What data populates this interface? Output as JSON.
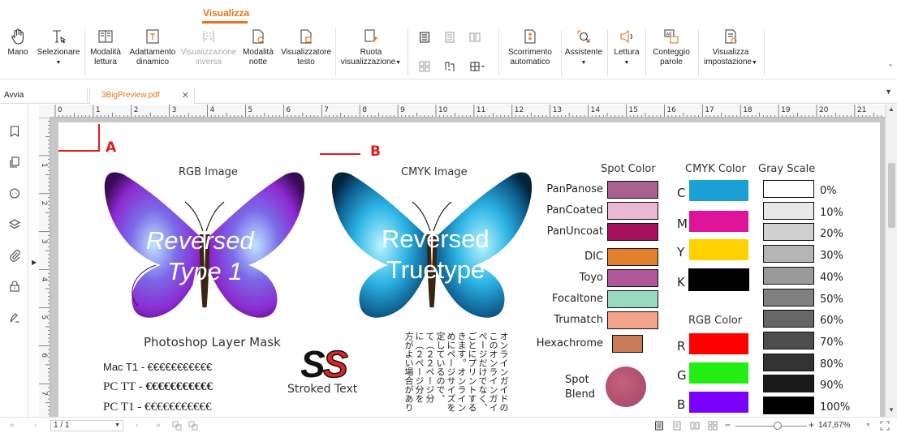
{
  "ribbon": {
    "active_tab": "Visualizza",
    "buttons": {
      "mano": "Mano",
      "selezionare": "Selezionare",
      "modalita_lettura_1": "Modalità",
      "modalita_lettura_2": "lettura",
      "adattamento_1": "Adattamento",
      "adattamento_2": "dinamico",
      "vis_inversa_1": "Visualizzazione",
      "vis_inversa_2": "inversa",
      "mod_notte_1": "Modalità",
      "mod_notte_2": "notte",
      "vis_testo_1": "Visualizzatore",
      "vis_testo_2": "testo",
      "ruota_1": "Ruota",
      "ruota_2": "visualizzazione",
      "scorrimento_1": "Scorrimento",
      "scorrimento_2": "automatico",
      "assistente": "Assistente",
      "lettura": "Lettura",
      "conteggio_1": "Conteggio",
      "conteggio_2": "parole",
      "visualizza_imp_1": "Visualizza",
      "visualizza_imp_2": "impostazione"
    }
  },
  "tabs": {
    "home": "Avvia",
    "file": "3BigPreview.pdf"
  },
  "ruler": {
    "marks": [
      "0",
      "1",
      "2",
      "3",
      "4",
      "5",
      "6",
      "7",
      "8",
      "9",
      "10",
      "11",
      "12",
      "13",
      "14",
      "15",
      "16",
      "17",
      "18",
      "19",
      "20",
      "21"
    ],
    "left_marks": [
      "1",
      "2",
      "3",
      "4",
      "5",
      "6",
      "7"
    ]
  },
  "page": {
    "marker_a": "A",
    "marker_b": "B",
    "rgb_title": "RGB Image",
    "cmyk_title": "CMYK Image",
    "rev_type1_a": "Reversed",
    "rev_type1_b": "Type 1",
    "rev_tt_a": "Reversed",
    "rev_tt_b": "Truetype",
    "ps_mask": "Photoshop Layer Mask",
    "mac_t1_label": "Mac T1 - ",
    "pc_tt_label": "PC TT - ",
    "pc_t1_label": "PC T1 - ",
    "euro_line_1": "€€€€€€€€€€€",
    "euro_line_2": "€€€€€€€€€€€",
    "euro_line_3": "€€€€€€€€€€€",
    "ss_logo_1": "S",
    "ss_logo_2": "S",
    "stroked_text": "Stroked Text",
    "jp_columns": [
      "オンラインガイドの",
      "このオンラインガイ",
      "ページだけでなく、",
      "ごとにプリントする",
      "きます。オンライン",
      "めにページサイズを",
      "定しているので、",
      "て（２２ページ分",
      "に（２ページ分を",
      "方がよい場合があり"
    ],
    "spot_color_title": "Spot Color",
    "cmyk_color_title": "CMYK Color",
    "gray_scale_title": "Gray Scale",
    "rgb_color_title": "RGB Color",
    "spot_names": [
      "PanPanose",
      "PanCoated",
      "PanUncoat",
      "DIC",
      "Toyo",
      "Focaltone",
      "Trumatch",
      "Hexachrome"
    ],
    "spot_colors": [
      "#a8608f",
      "#e8b7d2",
      "#a5115c",
      "#e07f2c",
      "#b0579a",
      "#99d9c1",
      "#f4a48a",
      "#c87a55"
    ],
    "cmyk_letters": [
      "C",
      "M",
      "Y",
      "K"
    ],
    "cmyk_colors": [
      "#1ba0d7",
      "#e0139b",
      "#ffd200",
      "#000000"
    ],
    "rgb_letters": [
      "R",
      "G",
      "B"
    ],
    "rgb_colors": [
      "#ff0000",
      "#22ee11",
      "#7a00ff"
    ],
    "gray_labels": [
      "0%",
      "10%",
      "20%",
      "30%",
      "40%",
      "50%",
      "60%",
      "70%",
      "80%",
      "90%",
      "100%"
    ],
    "gray_colors": [
      "#ffffff",
      "#e8e8e8",
      "#d0d0d0",
      "#b4b4b4",
      "#999999",
      "#808080",
      "#666666",
      "#4d4d4d",
      "#333333",
      "#1a1a1a",
      "#000000"
    ],
    "spot_blend_1": "Spot",
    "spot_blend_2": "Blend"
  },
  "status": {
    "page_value": "1 / 1",
    "zoom": "147,67%"
  }
}
